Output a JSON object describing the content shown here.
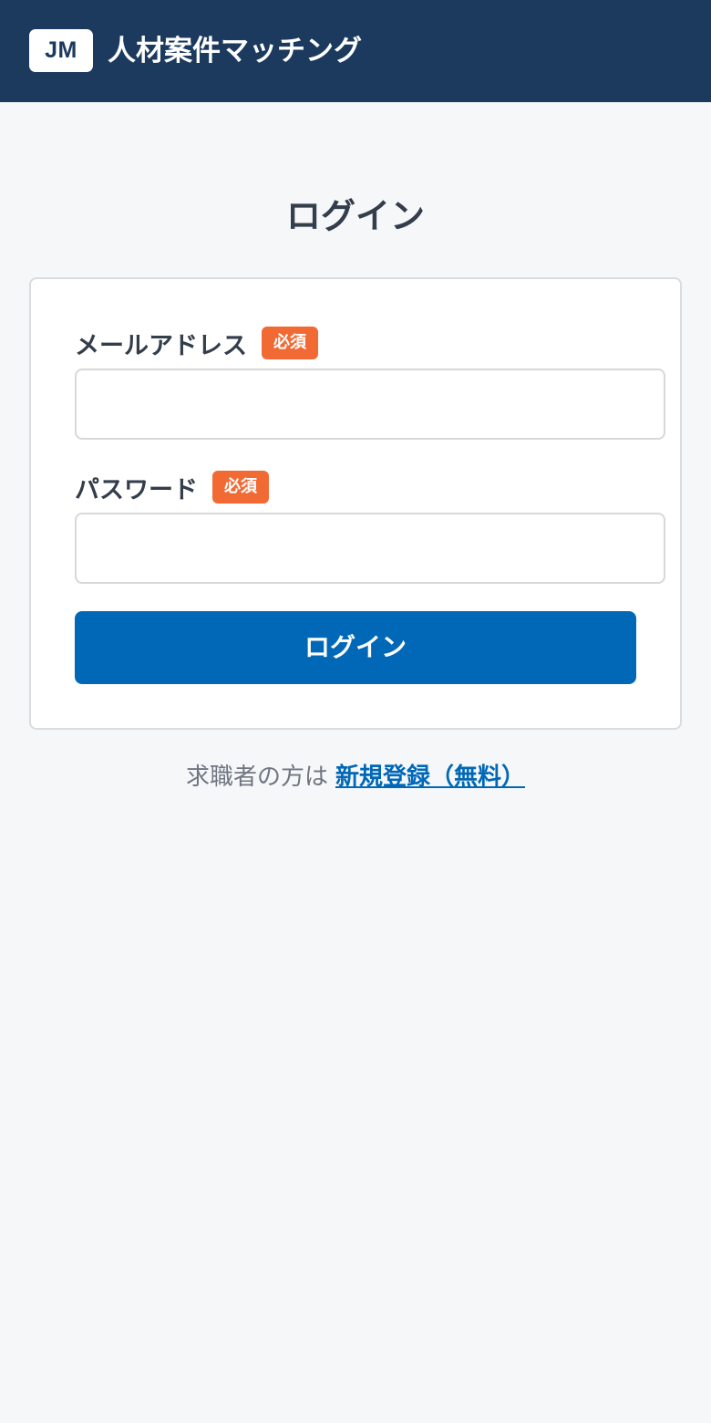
{
  "header": {
    "logo_text": "JM",
    "app_title": "人材案件マッチング"
  },
  "page": {
    "title": "ログイン"
  },
  "form": {
    "email": {
      "label": "メールアドレス",
      "required_badge": "必須",
      "value": ""
    },
    "password": {
      "label": "パスワード",
      "required_badge": "必須",
      "value": ""
    },
    "submit_label": "ログイン"
  },
  "register": {
    "prefix": "求職者の方は",
    "link_text": "新規登録（無料）"
  },
  "colors": {
    "header_bg": "#1b3a5e",
    "primary": "#0068b7",
    "required_badge": "#f26a33",
    "page_bg": "#f6f7f9"
  }
}
